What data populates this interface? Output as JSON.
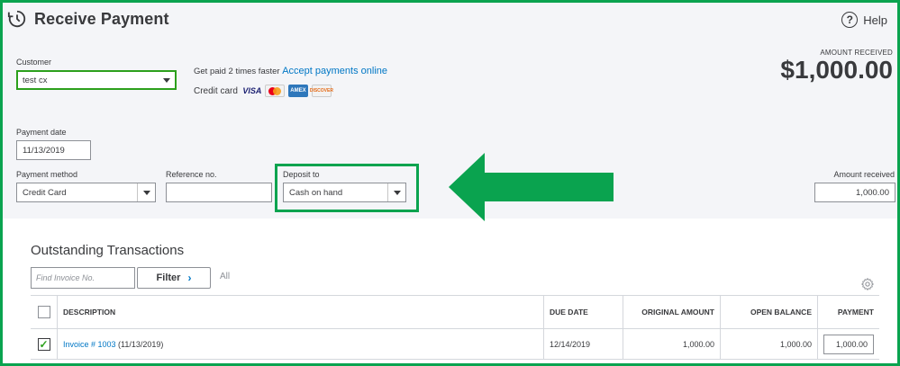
{
  "header": {
    "title": "Receive Payment",
    "help_label": "Help",
    "help_glyph": "?"
  },
  "amount_received_summary": {
    "label": "AMOUNT RECEIVED",
    "value": "$1,000.00"
  },
  "customer": {
    "label": "Customer",
    "value": "test cx"
  },
  "promo": {
    "text": "Get paid 2 times faster",
    "link": "Accept payments online",
    "credit_card_label": "Credit card",
    "cards": [
      "visa-icon",
      "mastercard-icon",
      "amex-icon",
      "discover-icon"
    ],
    "visa_text": "VISA",
    "amex_text": "AMEX",
    "discover_text": "DISCOVER"
  },
  "payment_date": {
    "label": "Payment date",
    "value": "11/13/2019"
  },
  "payment_method": {
    "label": "Payment method",
    "value": "Credit Card"
  },
  "reference": {
    "label": "Reference no.",
    "value": ""
  },
  "deposit_to": {
    "label": "Deposit to",
    "value": "Cash on hand"
  },
  "amount_received": {
    "label": "Amount received",
    "value": "1,000.00"
  },
  "outstanding": {
    "title": "Outstanding Transactions",
    "find_placeholder": "Find Invoice No.",
    "filter_label": "Filter",
    "filter_chevron": "›",
    "all_label": "All",
    "columns": [
      "DESCRIPTION",
      "DUE DATE",
      "ORIGINAL AMOUNT",
      "OPEN BALANCE",
      "PAYMENT"
    ],
    "rows": [
      {
        "checked": true,
        "check_glyph": "✓",
        "invoice_link": "Invoice # 1003",
        "invoice_date": " (11/13/2019)",
        "due_date": "12/14/2019",
        "original_amount": "1,000.00",
        "open_balance": "1,000.00",
        "payment": "1,000.00"
      }
    ]
  },
  "colors": {
    "accent_green": "#0aa34f",
    "link_blue": "#0077c5",
    "header_bg": "#f4f5f8"
  }
}
